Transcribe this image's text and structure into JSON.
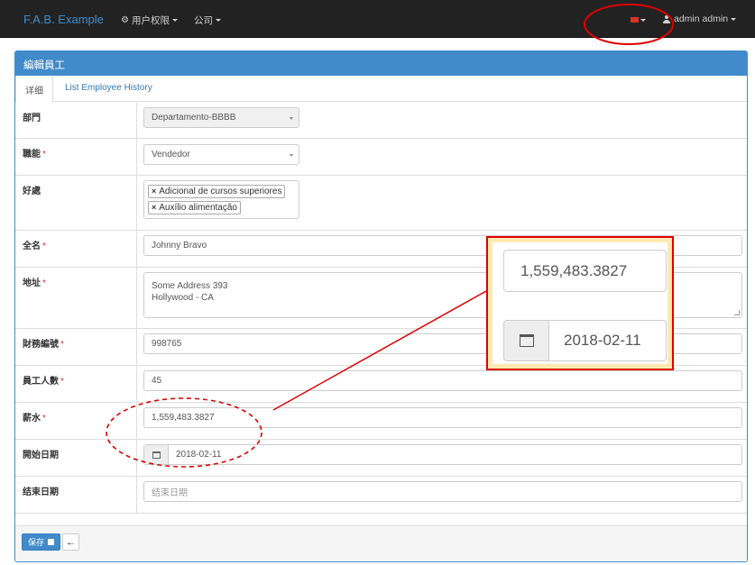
{
  "navbar": {
    "brand": "F.A.B. Example",
    "menu_permissions": "用户权限",
    "menu_company": "公司",
    "user_label": "admin admin"
  },
  "panel": {
    "title": "編輯員工",
    "tabs": [
      {
        "label": "详细"
      },
      {
        "label": "List Employee History"
      }
    ]
  },
  "form": {
    "department": {
      "label": "部門",
      "value": "Departamento-BBBB"
    },
    "function": {
      "label": "職能",
      "required": "*",
      "value": "Vendedor"
    },
    "benefits": {
      "label": "好處",
      "tags": [
        "Adicional de cursos superiores",
        "Auxílio alimentação"
      ]
    },
    "full_name": {
      "label": "全名",
      "required": "*",
      "value": "Johnny Bravo"
    },
    "address": {
      "label": "地址",
      "required": "*",
      "line1": "Some Address 393",
      "line2": "Hollywood - CA"
    },
    "fiscal_number": {
      "label": "財務編號",
      "required": "*",
      "value": "998765"
    },
    "employee_number": {
      "label": "員工人數",
      "required": "*",
      "value": "45"
    },
    "salary": {
      "label": "薪水",
      "required": "*",
      "value": "1,559,483.3827"
    },
    "begin_date": {
      "label": "開始日期",
      "value": "2018-02-11"
    },
    "end_date": {
      "label": "结束日期",
      "placeholder": "结束日期"
    }
  },
  "footer": {
    "save_label": "保存"
  },
  "zoom": {
    "salary_value": "1,559,483.3827",
    "date_value": "2018-02-11"
  },
  "colors": {
    "primary": "#428bca",
    "navbar": "#222222",
    "annotation": "#e00000",
    "zoom_background": "#fce9b2"
  }
}
